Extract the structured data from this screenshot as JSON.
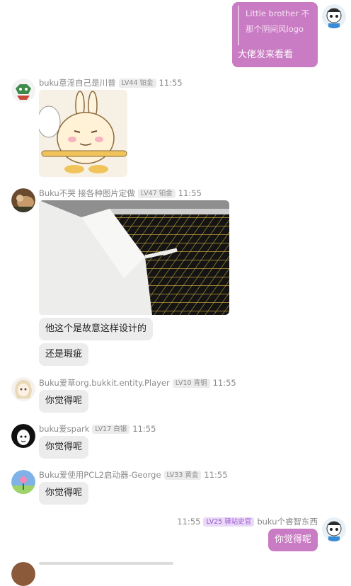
{
  "messages": {
    "m1": {
      "quote": "Little brother 不那个阴间风logo",
      "reply": "大佬发来看看"
    },
    "m2": {
      "username": "buku意淫自己是川普",
      "level": "LV44 铂金",
      "time": "11:55"
    },
    "m3": {
      "username": "Buku不哭 接各种图片定做",
      "level": "LV47 铂金",
      "time": "11:55",
      "text1": "他这个是故意这样设计的",
      "text2": "还是瑕疵"
    },
    "m4": {
      "username": "Buku爱草org.bukkit.entity.Player",
      "level": "LV10 青铜",
      "time": "11:55",
      "text": "你觉得呢"
    },
    "m5": {
      "username": "buku爱spark",
      "level": "LV17 白银",
      "time": "11:55",
      "text": "你觉得呢"
    },
    "m6": {
      "username": "Buku爱使用PCL2启动器-George",
      "level": "LV33 黄金",
      "time": "11:55",
      "text": "你觉得呢"
    },
    "m7": {
      "time": "11:55",
      "level": "LV25 驿站史官",
      "username": "buku个睿智东西",
      "text": "你觉得呢"
    }
  },
  "colors": {
    "self_bubble": "#c97bc3",
    "other_bubble": "#ececec",
    "level_purple": "#9b59d0"
  }
}
